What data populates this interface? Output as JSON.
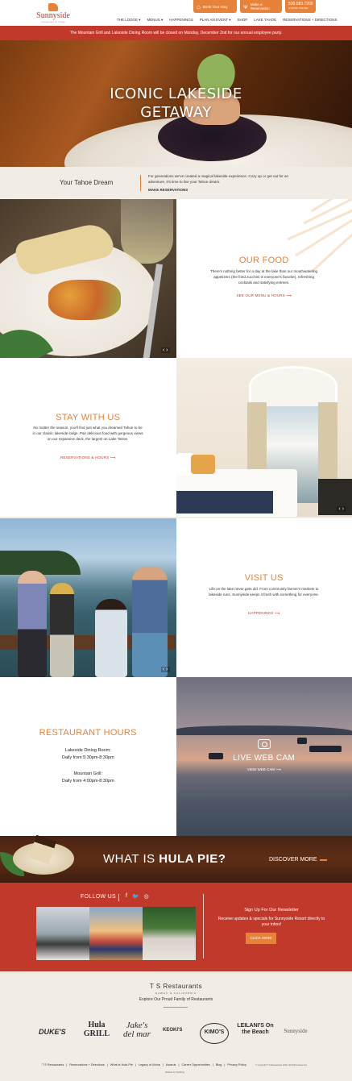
{
  "brand": {
    "name": "Sunnyside",
    "tagline": "restaurant & lodge",
    "accent": "#e8823a",
    "red": "#c0392b"
  },
  "top_buttons": [
    {
      "icon": "bed-icon",
      "label": "Book Your Stay"
    },
    {
      "icon": "dining-icon",
      "label": "Make a Reservation"
    },
    {
      "icon": "phone-icon",
      "label": "530.583.7200",
      "sub": "or BOOK ONLINE"
    }
  ],
  "nav": [
    "THE LODGE ▾",
    "MENUS ▾",
    "HAPPENINGS",
    "PLAN AN EVENT ▾",
    "SHOP",
    "LAKE TAHOE",
    "RESERVATIONS + DIRECTIONS"
  ],
  "alert": "The Mountain Grill and Lakeside Dining Room will be closed on Monday, December 2nd for our annual employee party.",
  "hero": {
    "line1": "ICONIC LAKESIDE",
    "line2": "GETAWAY"
  },
  "dream": {
    "title": "Your Tahoe Dream",
    "text": "For generations we've created a magical lakeside experience. Cozy up or get out for an adventure, it's time to live your Tahoe dream.",
    "cta": "MAKE RESERVATIONS"
  },
  "food": {
    "title": "OUR FOOD",
    "text": "There's nothing better for a day at the lake than our mouthwatering appetizers (the fried zucchini is everyone's favorite), refreshing cocktails and satisfying entrees.",
    "link": "SEE OUR MENU & HOURS ⟶"
  },
  "stay": {
    "title": "STAY WITH US",
    "text": "No matter the season, you'll find just what you dreamed Tahoe to be in our classic lakeside lodge. Pair delicious food with gorgeous views on our expansive deck, the largest on Lake Tahoe.",
    "link": "RESERVATIONS & HOURS ⟶"
  },
  "visit": {
    "title": "VISIT US",
    "text": "Life on the lake never gets old. From community farmer's markets to lakeside runs, Sunnyside keeps it fresh with something for everyone.",
    "link": "HAPPENINGS ⟶"
  },
  "hours": {
    "title": "RESTAURANT HOURS",
    "lakeside_name": "Lakeside Dining Room:",
    "lakeside_time": "Daily from 5:30pm-8:30pm",
    "grill_name": "Mountain Grill:",
    "grill_time": "Daily from 4:00pm-8:30pm"
  },
  "webcam": {
    "title": "LIVE WEB CAM",
    "link": "VIEW WEB CAM ⟶"
  },
  "hula": {
    "q_pre": "WHAT IS ",
    "q_bold": "HULA PIE?",
    "cta": "DISCOVER MORE"
  },
  "social": {
    "label": "FOLLOW US",
    "icons": [
      "f",
      "🐦",
      "◎"
    ]
  },
  "newsletter": {
    "title": "Sign Up For Our Newsletter",
    "text": "Receive updates & specials for Sunnyside Resort directly to your inbox!",
    "button": "CLICK HERE"
  },
  "family": {
    "title": "T S Restaurants",
    "subtitle": "HAWAII & CALIFORNIA",
    "explore": "Explore Our Proud Family of Restaurants",
    "brands": [
      "DUKE'S",
      "Hula GRILL",
      "Jake's del mar",
      "KEOKI'S",
      "KIMO'S",
      "LEILANI'S On the Beach",
      "Sunnyside"
    ]
  },
  "footer_links": [
    "T S Restaurants",
    "|",
    "Reservations + Directions",
    "|",
    "What is Hula Pie",
    "|",
    "Legacy of Aloha",
    "|",
    "Awards",
    "|",
    "Career Opportunities",
    "|",
    "Blog",
    "|",
    "Privacy Policy"
  ],
  "copyright": "© Copyright T S Restaurants 2019. All Rights Reserved.",
  "credit": "Website by Starfiring"
}
